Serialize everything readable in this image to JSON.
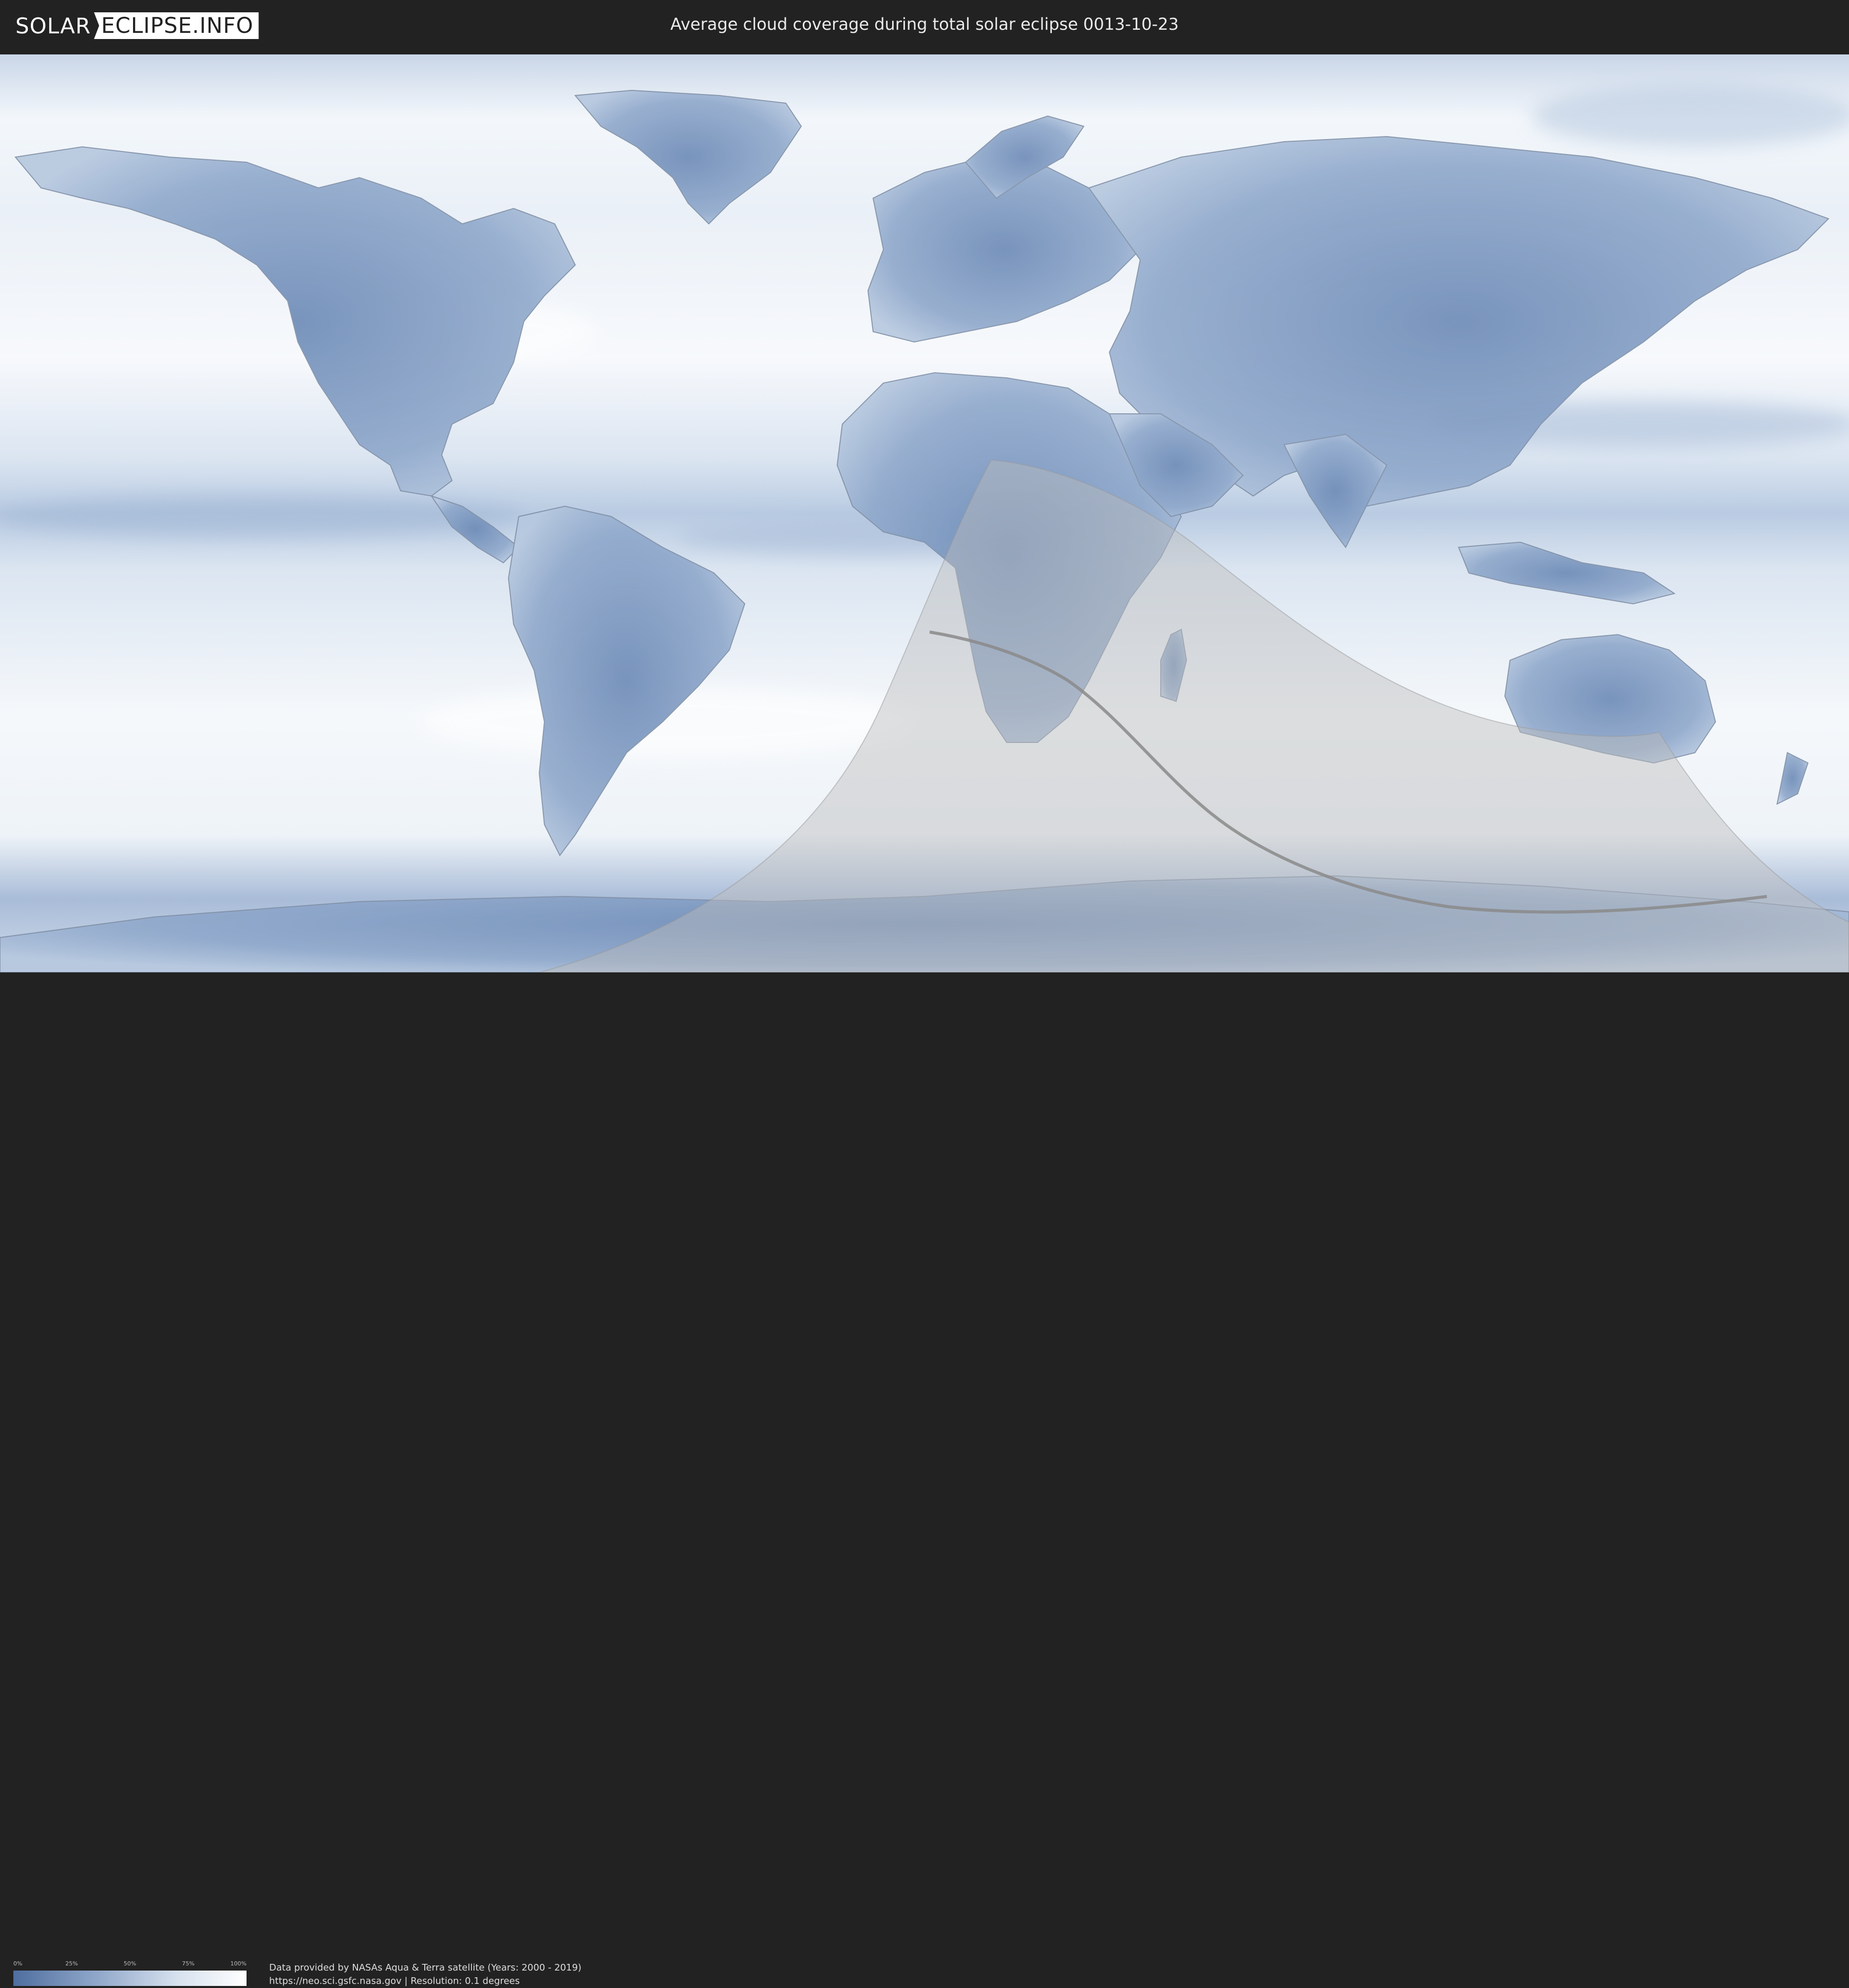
{
  "header": {
    "logo_left": "SOLAR",
    "logo_right": "ECLIPSE.INFO",
    "title": "Average cloud coverage during total solar eclipse 0013-10-23"
  },
  "legend": {
    "ticks": [
      "0%",
      "25%",
      "50%",
      "75%",
      "100%"
    ],
    "gradient_colors": [
      "#4f6e9f",
      "#8ea6c9",
      "#d6e1ee",
      "#ffffff"
    ]
  },
  "credits": {
    "line1": "Data provided by NASAs Aqua & Terra satellite (Years: 2000 - 2019)",
    "line2": "https://neo.sci.gsfc.nasa.gov | Resolution: 0.1 degrees"
  },
  "colors": {
    "background": "#222222",
    "ocean_cloud": "#dfe8f3",
    "land_dark_cloud": "#6f8db8",
    "eclipse_shadow": "#bdbdbd",
    "central_line": "#888888"
  }
}
